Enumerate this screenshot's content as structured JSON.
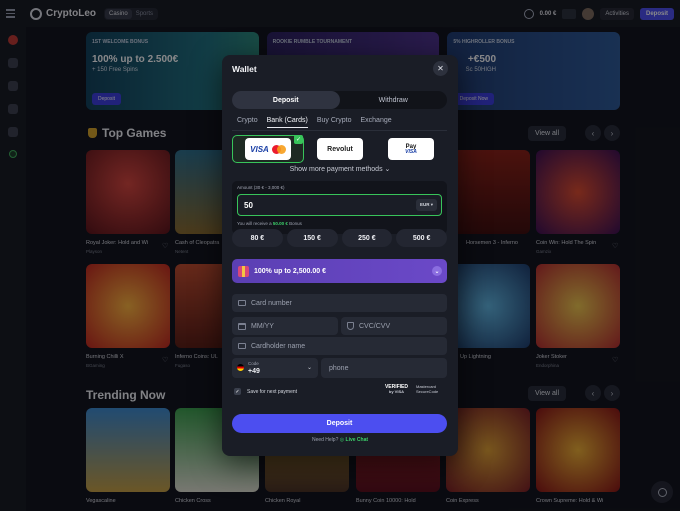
{
  "topbar": {
    "brand": "CryptoLeo",
    "switch_casino": "Casino",
    "switch_sports": "Sports",
    "balance": "0.00 €",
    "activities": "Activities",
    "deposit": "Deposit"
  },
  "banners": [
    {
      "tag": "1ST WELCOME BONUS",
      "headline": "100% up to 2.500€",
      "sub": "+ 150 Free Spins",
      "button": "Deposit"
    },
    {
      "tag": "ROOKIE RUMBLE TOURNAMENT",
      "headline": "",
      "sub": "",
      "button": ""
    },
    {
      "tag": "5% HIGHROLLER BONUS",
      "headline": "+€500",
      "sub": "Sc 50HIGH",
      "button": "Deposit Now"
    }
  ],
  "sections": {
    "top_games": "Top Games",
    "trending": "Trending Now",
    "view_all": "View all"
  },
  "top_games": [
    {
      "name": "Royal Joker: Hold and Wi",
      "provider": "Playson"
    },
    {
      "name": "Cash of Cleopatra",
      "provider": "Netent"
    },
    {
      "name": "Horsemen 3 - Inferno",
      "provider": ""
    },
    {
      "name": "Coin Win: Hold The Spin",
      "provider": "Gamzix"
    }
  ],
  "second_row": [
    {
      "name": "Burning Chilli X",
      "provider": "BGaming"
    },
    {
      "name": "Inferno Coins: UL",
      "provider": "Fugaso"
    },
    {
      "name": "Up Lightning",
      "provider": ""
    },
    {
      "name": "Joker Stoker",
      "provider": "Endorphina"
    }
  ],
  "trending": [
    {
      "name": "Vegascaline",
      "provider": ""
    },
    {
      "name": "Chicken Cross",
      "provider": ""
    },
    {
      "name": "Chicken Royal",
      "provider": ""
    },
    {
      "name": "Bunny Coin 10000: Hold",
      "provider": ""
    },
    {
      "name": "Coin Express",
      "provider": ""
    },
    {
      "name": "Crown Supreme: Hold & Wi",
      "provider": ""
    }
  ],
  "wallet": {
    "title": "Wallet",
    "tabs": [
      "Deposit",
      "Withdraw"
    ],
    "methods": [
      "Crypto",
      "Bank (Cards)",
      "Buy Crypto",
      "Exchange"
    ],
    "payment_cards": {
      "visa": "VISA",
      "revolut": "Revolut",
      "applepay_top": "Pay",
      "applepay_bottom": "VISA"
    },
    "more_methods": "Show more payment methods",
    "amount_label": "Amount (30 € - 3,000 €)",
    "amount_value": "50",
    "currency": "EUR",
    "bonus_hint_prefix": "You will receive a ",
    "bonus_hint_amount": "50.00 €",
    "bonus_hint_suffix": " Bonus",
    "quick_amounts": [
      "80 €",
      "150 €",
      "250 €",
      "500 €"
    ],
    "promo": "100% up to 2,500.00 €",
    "fields": {
      "card_number": "Card number",
      "expiry": "MM/YY",
      "cvc": "CVC/CVV",
      "cardholder": "Cardholder name",
      "code_label": "Code",
      "code_value": "+49",
      "phone": "phone"
    },
    "save_label": "Save for next payment",
    "verified": "VERIFIED",
    "verified_by": "by VISA",
    "mc_secure": "Mastercard SecureCode",
    "deposit_button": "Deposit",
    "help": "Need Help?",
    "live_chat": "Live Chat"
  }
}
